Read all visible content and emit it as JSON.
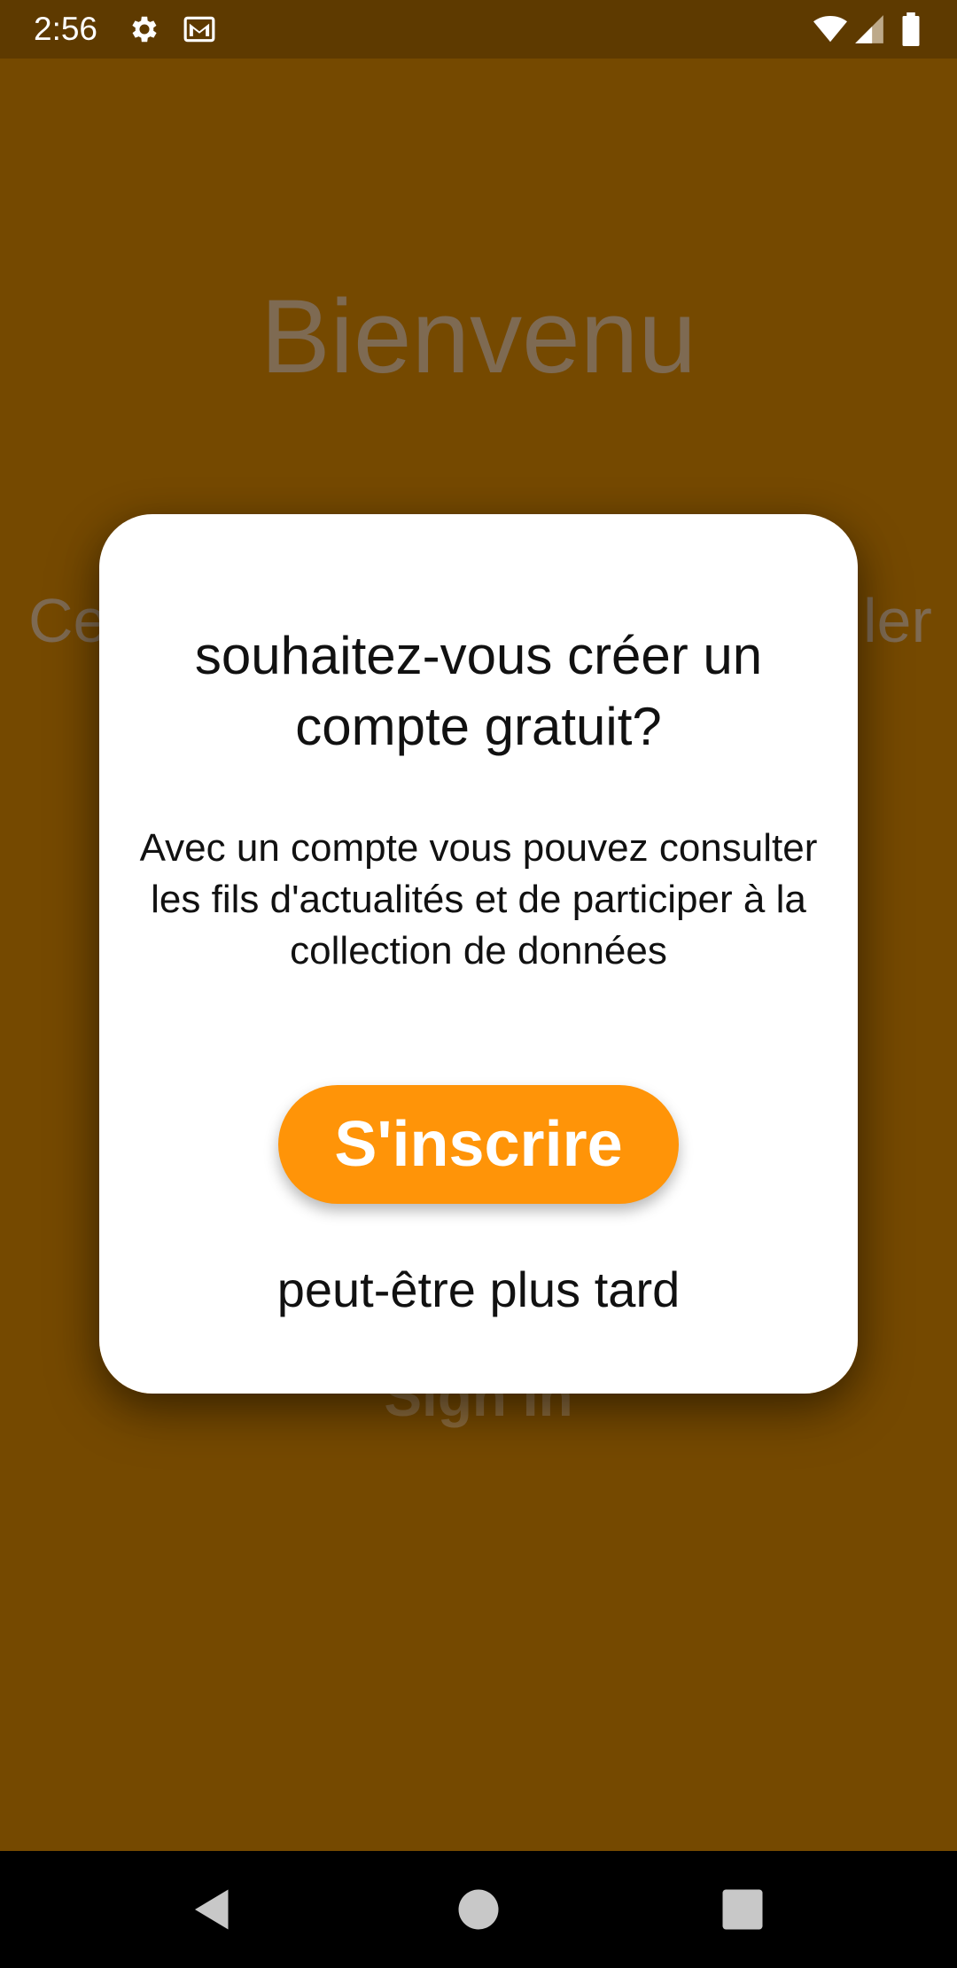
{
  "status_bar": {
    "time": "2:56",
    "icons": [
      "settings-icon",
      "gmail-icon",
      "wifi-icon",
      "signal-icon",
      "battery-icon"
    ]
  },
  "background": {
    "title": "Bienvenu",
    "text_fragment_left": "Ce",
    "text_fragment_right": "ler",
    "signin_label": "Sign In"
  },
  "dialog": {
    "title": "souhaitez-vous créer un compte gratuit?",
    "message": "Avec un compte vous pouvez consulter les fils d'actualités et de participer à la collection de données",
    "primary_button": "S'inscrire",
    "secondary_link": "peut-être plus tard"
  },
  "nav_bar": {
    "buttons": [
      "back-icon",
      "home-icon",
      "recents-icon"
    ]
  },
  "colors": {
    "background": "#754900",
    "status_bar": "#5e3a00",
    "accent": "#ff9408",
    "dialog": "#ffffff"
  }
}
